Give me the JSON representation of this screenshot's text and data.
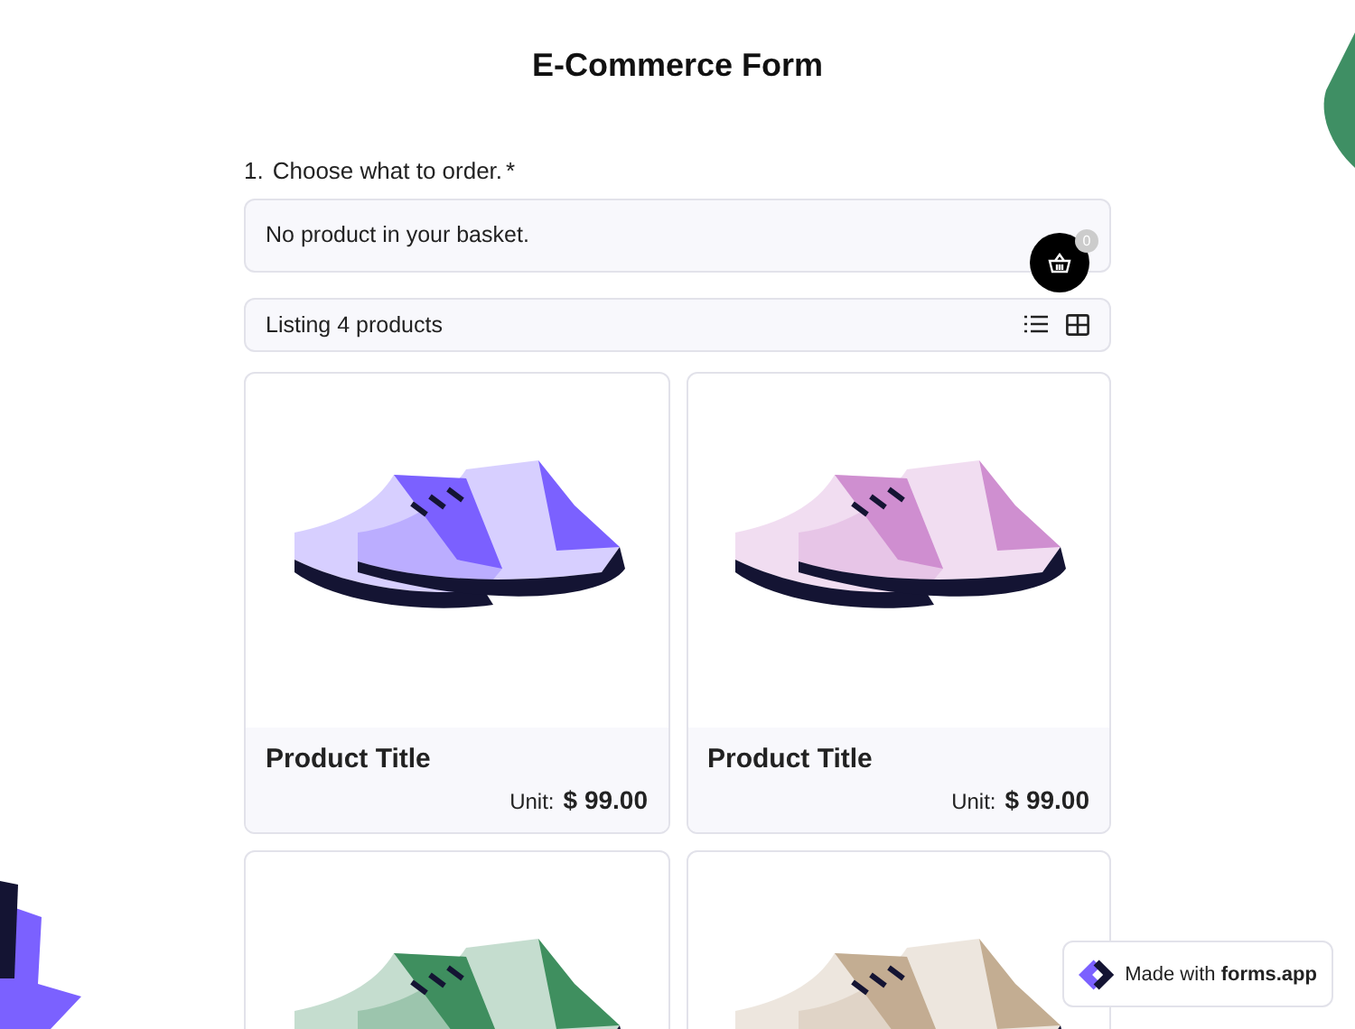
{
  "form": {
    "title": "E-Commerce Form"
  },
  "question": {
    "number": "1.",
    "label": "Choose what to order.",
    "required_mark": "*"
  },
  "basket": {
    "message": "No product in your basket.",
    "count": "0"
  },
  "listing": {
    "label": "Listing 4 products"
  },
  "products": [
    {
      "title": "Product Title",
      "unit_label": "Unit:",
      "price": "$ 99.00",
      "color": "#7b61ff"
    },
    {
      "title": "Product Title",
      "unit_label": "Unit:",
      "price": "$ 99.00",
      "color": "#cf8fd0"
    },
    {
      "color": "#3f8f5f"
    },
    {
      "color": "#c3ad92"
    }
  ],
  "badge": {
    "prefix": "Made with",
    "brand": "forms.app"
  }
}
